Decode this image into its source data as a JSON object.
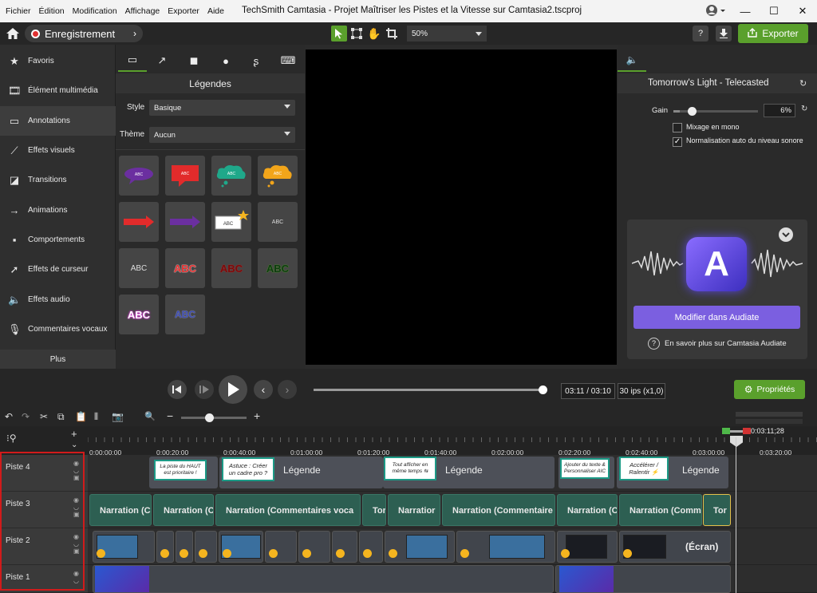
{
  "menu": [
    "Fichier",
    "Édition",
    "Modification",
    "Affichage",
    "Exporter",
    "Aide"
  ],
  "window_title": "TechSmith Camtasia - Projet Maîtriser les Pistes et la Vitesse sur Camtasia2.tscproj",
  "toolbar": {
    "record_label": "Enregistrement",
    "zoom_value": "50%",
    "help_label": "?",
    "export_label": "Exporter"
  },
  "left_nav": [
    {
      "label": "Favoris",
      "icon": "star-icon"
    },
    {
      "label": "Élément multimédia",
      "icon": "film-icon"
    },
    {
      "label": "Annotations",
      "icon": "annotation-icon"
    },
    {
      "label": "Effets visuels",
      "icon": "wand-icon"
    },
    {
      "label": "Transitions",
      "icon": "transition-icon"
    },
    {
      "label": "Animations",
      "icon": "animation-icon"
    },
    {
      "label": "Comportements",
      "icon": "behavior-icon"
    },
    {
      "label": "Effets de curseur",
      "icon": "cursor-icon"
    },
    {
      "label": "Effets audio",
      "icon": "speaker-icon"
    },
    {
      "label": "Commentaires vocaux",
      "icon": "microphone-icon"
    }
  ],
  "left_nav_more": "Plus",
  "annotations": {
    "title": "Légendes",
    "style_label": "Style",
    "style_value": "Basique",
    "theme_label": "Thème",
    "theme_value": "Aucun",
    "tile_text": "ABC"
  },
  "properties": {
    "audio_title": "Tomorrow's Light - Telecasted",
    "gain_label": "Gain",
    "gain_value": "6%",
    "gain_level": 0.08,
    "mono_label": "Mixage en mono",
    "mono_checked": false,
    "normalize_label": "Normalisation auto du niveau sonore",
    "normalize_checked": true,
    "audiate_button": "Modifier dans Audiate",
    "audiate_help": "En savoir plus sur Camtasia Audiate",
    "audiate_letter": "A"
  },
  "playback": {
    "time": "03:11 / 03:10",
    "fps": "30 ips (x1,0)",
    "progress": 1.0,
    "props_button": "Propriétés"
  },
  "timeline": {
    "playhead_time": "0:03:11;28",
    "ticks": [
      "0:00:00;00",
      "0:00:20;00",
      "0:00:40;00",
      "0:01:00;00",
      "0:01:20;00",
      "0:01:40;00",
      "0:02:00;00",
      "0:02:20;00",
      "0:02:40;00",
      "0:03:00;00",
      "0:03:20;00"
    ],
    "tracks": [
      "Piste 4",
      "Piste 3",
      "Piste 2",
      "Piste 1"
    ],
    "captions": [
      "La piste du HAUT est prioritaire !",
      "Astuce : Créer un cadre pro ?",
      "Tout afficher en même temps ⇆",
      "Ajouter du texte & Personnaliser AIC",
      "Accélérer / Ralentir ⚡"
    ],
    "legend_label": "Légende",
    "audio_clips": [
      "Narration (C",
      "Narration (C",
      "Narration (Commentaires voca",
      "Tor",
      "Narratior",
      "Narration (Commentaire",
      "Narration (C",
      "Narration (Comm",
      "Tor"
    ],
    "screen_label": "(Écran)"
  },
  "colors": {
    "accent_green": "#5aa02c",
    "record_red": "#e03030",
    "audiate_purple": "#7b5fe0",
    "selection_red": "#d11b1b"
  }
}
